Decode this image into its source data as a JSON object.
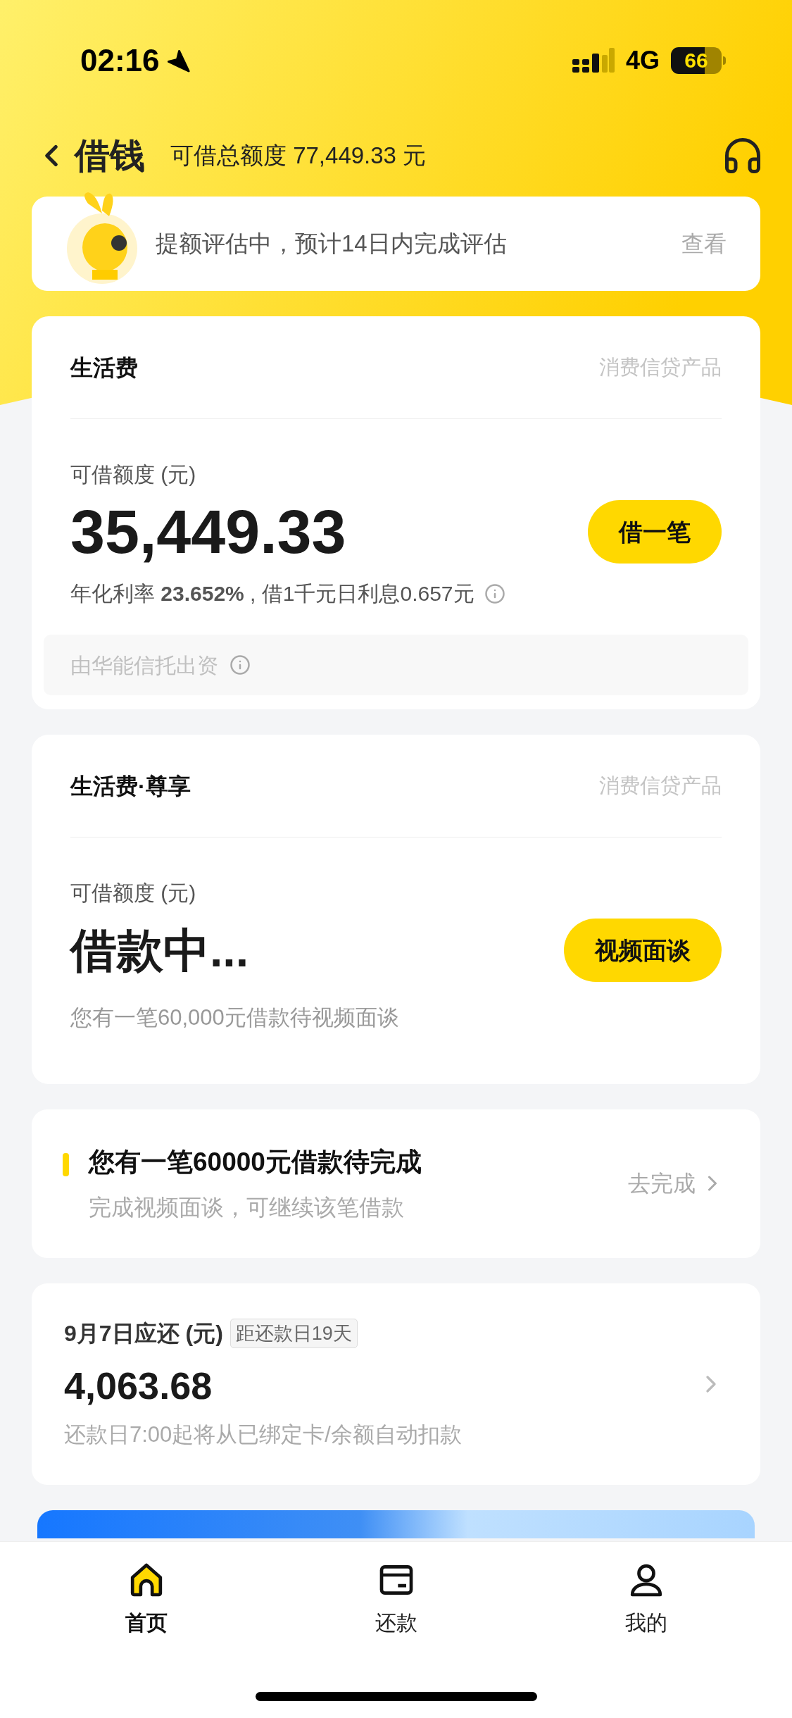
{
  "status_bar": {
    "time": "02:16",
    "network": "4G",
    "battery": "66"
  },
  "header": {
    "title": "借钱",
    "total": "可借总额度 77,449.33 元"
  },
  "notice": {
    "text": "提额评估中，预计14日内完成评估",
    "action": "查看"
  },
  "products": [
    {
      "kind": "available",
      "title": "生活费",
      "tag": "消费信贷产品",
      "amount_label": "可借额度 (元)",
      "amount": "35,449.33",
      "button": "借一笔",
      "rate": "年化利率 **23.652%** , 借1千元日利息0.657元",
      "funder": "由华能信托出资"
    },
    {
      "kind": "pending",
      "title": "生活费·尊享",
      "tag": "消费信贷产品",
      "amount_label": "可借额度 (元)",
      "amount": "借款中...",
      "button": "视频面谈",
      "note": "您有一笔60,000元借款待视频面谈"
    }
  ],
  "pending_task": {
    "title": "您有一笔60000元借款待完成",
    "subtitle": "完成视频面谈，可继续该笔借款",
    "action": "去完成"
  },
  "repayment": {
    "title": "9月7日应还 (元)",
    "badge": "距还款日19天",
    "amount": "4,063.68",
    "note": "还款日7:00起将从已绑定卡/余额自动扣款"
  },
  "tabs": [
    {
      "kind": "home",
      "label": "首页",
      "selected": true
    },
    {
      "kind": "repay",
      "label": "还款",
      "selected": false
    },
    {
      "kind": "me",
      "label": "我的",
      "selected": false
    }
  ]
}
